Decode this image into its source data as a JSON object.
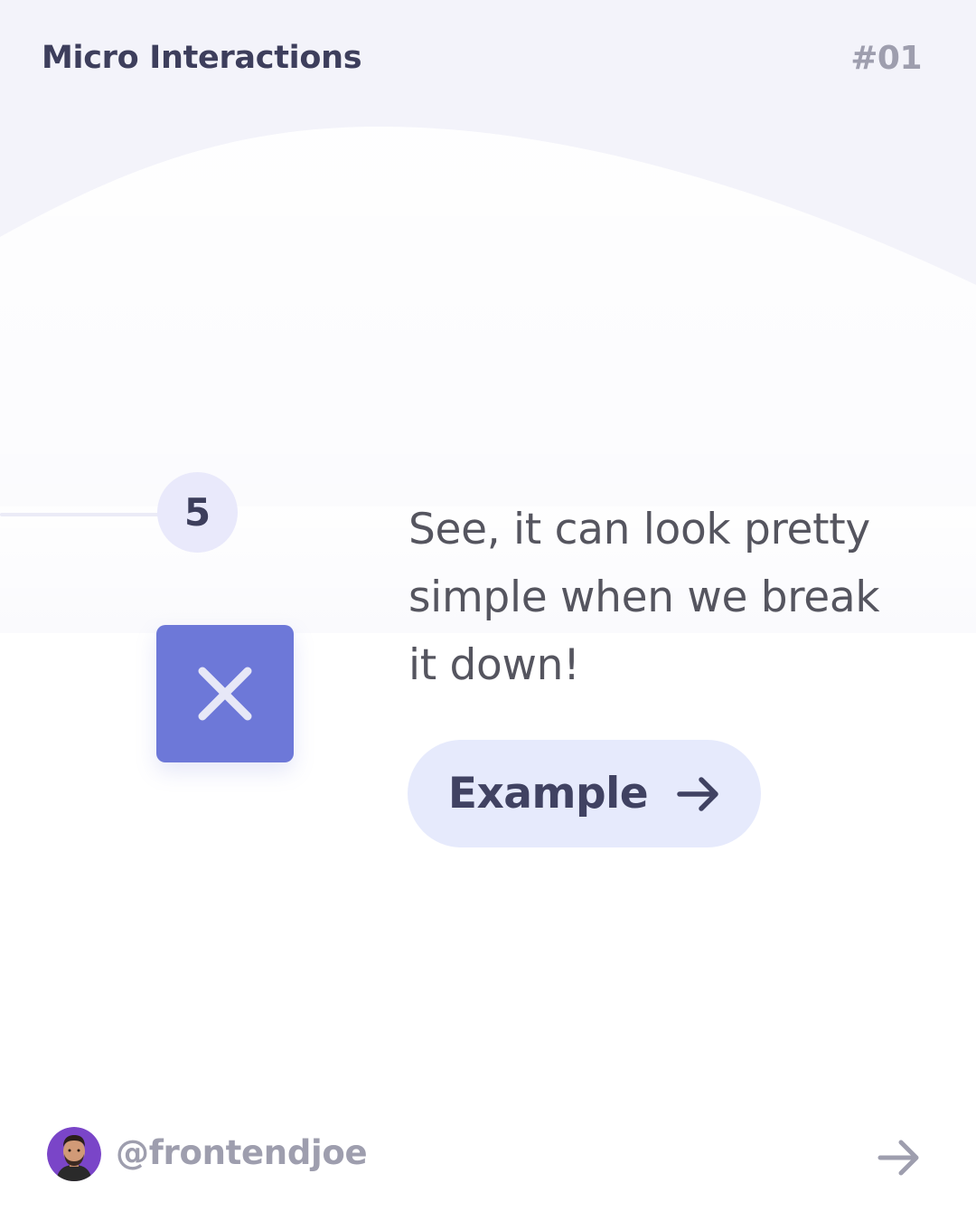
{
  "colors": {
    "page_background": "#ffffff",
    "wave_background": "#f3f3fa",
    "title_text": "#3d3e5c",
    "muted_text": "#9e9eae",
    "body_text": "#55555f",
    "accent": "#6d78d8",
    "button_background": "#e6eafc",
    "button_text": "#404262"
  },
  "header": {
    "title": "Micro Interactions",
    "number": "#01"
  },
  "step": {
    "number": "5"
  },
  "close_box": {
    "icon": "close-icon"
  },
  "main": {
    "text": "See, it can look pretty simple when we break it down!"
  },
  "cta": {
    "label": "Example",
    "icon": "arrow-right-icon"
  },
  "footer": {
    "avatar_icon": "avatar",
    "handle": "@frontendjoe",
    "next_icon": "arrow-right-icon"
  }
}
